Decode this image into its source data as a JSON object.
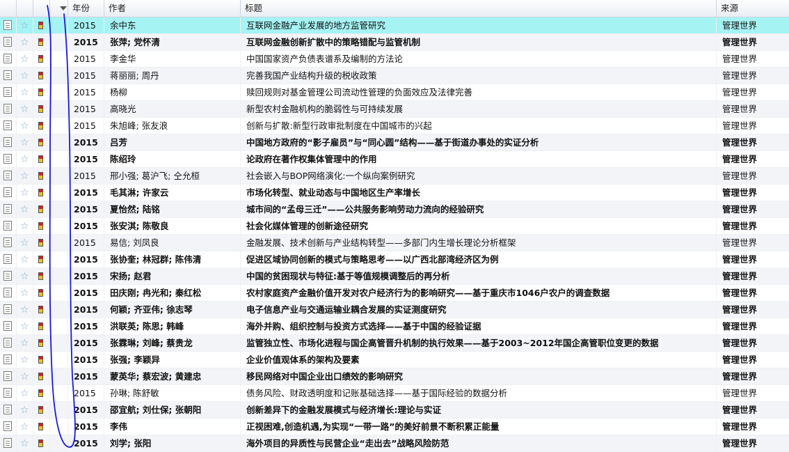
{
  "header": {
    "col_year": "年份",
    "col_author": "作者",
    "col_title": "标题",
    "col_source": "来源"
  },
  "rows": [
    {
      "year": "2015",
      "author": "余中东",
      "title": "互联网金融产业发展的地方监管研究",
      "source": "管理世界",
      "bold": false,
      "selected": true
    },
    {
      "year": "2015",
      "author": "张萍; 党怀清",
      "title": "互联网金融创新扩散中的策略错配与监管机制",
      "source": "管理世界",
      "bold": true
    },
    {
      "year": "2015",
      "author": "李金华",
      "title": "中国国家资产负债表谱系及编制的方法论",
      "source": "管理世界",
      "bold": false
    },
    {
      "year": "2015",
      "author": "蒋丽丽; 周丹",
      "title": "完善我国产业结构升级的税收政策",
      "source": "管理世界",
      "bold": false
    },
    {
      "year": "2015",
      "author": "杨柳",
      "title": "赎回规则对基金管理公司流动性管理的负面效应及法律完善",
      "source": "管理世界",
      "bold": false
    },
    {
      "year": "2015",
      "author": "高晓光",
      "title": "新型农村金融机构的脆弱性与可持续发展",
      "source": "管理世界",
      "bold": false
    },
    {
      "year": "2015",
      "author": "朱旭峰; 张友浪",
      "title": "创新与扩散:新型行政审批制度在中国城市的兴起",
      "source": "管理世界",
      "bold": false
    },
    {
      "year": "2015",
      "author": "吕芳",
      "title": "中国地方政府的“影子雇员”与“同心圆”结构——基于街道办事处的实证分析",
      "source": "管理世界",
      "bold": true
    },
    {
      "year": "2015",
      "author": "陈绍玲",
      "title": "论政府在著作权集体管理中的作用",
      "source": "管理世界",
      "bold": true
    },
    {
      "year": "2015",
      "author": "邢小强; 葛沪飞; 仝允桓",
      "title": "社会嵌入与BOP网络演化:一个纵向案例研究",
      "source": "管理世界",
      "bold": false
    },
    {
      "year": "2015",
      "author": "毛其淋; 许家云",
      "title": "市场化转型、就业动态与中国地区生产率增长",
      "source": "管理世界",
      "bold": true
    },
    {
      "year": "2015",
      "author": "夏怡然; 陆铭",
      "title": "城市间的“孟母三迁”——公共服务影响劳动力流向的经验研究",
      "source": "管理世界",
      "bold": true
    },
    {
      "year": "2015",
      "author": "张安淇; 陈敬良",
      "title": "社会化媒体管理的创新途径研究",
      "source": "管理世界",
      "bold": true
    },
    {
      "year": "2015",
      "author": "易信; 刘凤良",
      "title": "金融发展、技术创新与产业结构转型——多部门内生增长理论分析框架",
      "source": "管理世界",
      "bold": false
    },
    {
      "year": "2015",
      "author": "张协奎; 林冠群; 陈伟清",
      "title": "促进区域协同创新的模式与策略思考——以广西北部湾经济区为例",
      "source": "管理世界",
      "bold": true
    },
    {
      "year": "2015",
      "author": "宋扬; 赵君",
      "title": "中国的贫困现状与特征:基于等值规模调整后的再分析",
      "source": "管理世界",
      "bold": true
    },
    {
      "year": "2015",
      "author": "田庆刚; 冉光和; 秦红松",
      "title": "农村家庭资产金融价值开发对农户经济行为的影响研究——基于重庆市1046户农户的调查数据",
      "source": "管理世界",
      "bold": true
    },
    {
      "year": "2015",
      "author": "何颖; 齐亚伟; 徐志琴",
      "title": "电子信息产业与交通运输业耦合发展的实证测度研究",
      "source": "管理世界",
      "bold": true
    },
    {
      "year": "2015",
      "author": "洪联英; 陈思; 韩峰",
      "title": "海外并购、组织控制与投资方式选择——基于中国的经验证据",
      "source": "管理世界",
      "bold": true
    },
    {
      "year": "2015",
      "author": "张霖琳; 刘峰; 蔡贵龙",
      "title": "监管独立性、市场化进程与国企高管晋升机制的执行效果——基于2003~2012年国企高管职位变更的数据",
      "source": "管理世界",
      "bold": true
    },
    {
      "year": "2015",
      "author": "张强; 李颖异",
      "title": "企业价值观体系的架构及要素",
      "source": "管理世界",
      "bold": true
    },
    {
      "year": "2015",
      "author": "蒙英华; 蔡宏波; 黄建忠",
      "title": "移民网络对中国企业出口绩效的影响研究",
      "source": "管理世界",
      "bold": true
    },
    {
      "year": "2015",
      "author": "孙琳; 陈舒敏",
      "title": "债务风险、财政透明度和记账基础选择——基于国际经验的数据分析",
      "source": "管理世界",
      "bold": false
    },
    {
      "year": "2015",
      "author": "邵宜航; 刘仕保; 张朝阳",
      "title": "创新差异下的金融发展模式与经济增长:理论与实证",
      "source": "管理世界",
      "bold": true
    },
    {
      "year": "2015",
      "author": "李伟",
      "title": "正视困难,创造机遇,为实现“一带一路”的美好前景不断积累正能量",
      "source": "管理世界",
      "bold": true
    },
    {
      "year": "2015",
      "author": "刘学; 张阳",
      "title": "海外项目的异质性与民营企业“走出去”战略风险防范",
      "source": "管理世界",
      "bold": true
    }
  ],
  "colors": {
    "selected_row": "#a6f3f4",
    "alt_row": "#f2f4f7",
    "annotation": "#1a1ad6"
  },
  "icons": {
    "col0": "document-icon",
    "col1": "star-icon",
    "col2": "flag-icon",
    "sort": "sort-down-icon"
  }
}
